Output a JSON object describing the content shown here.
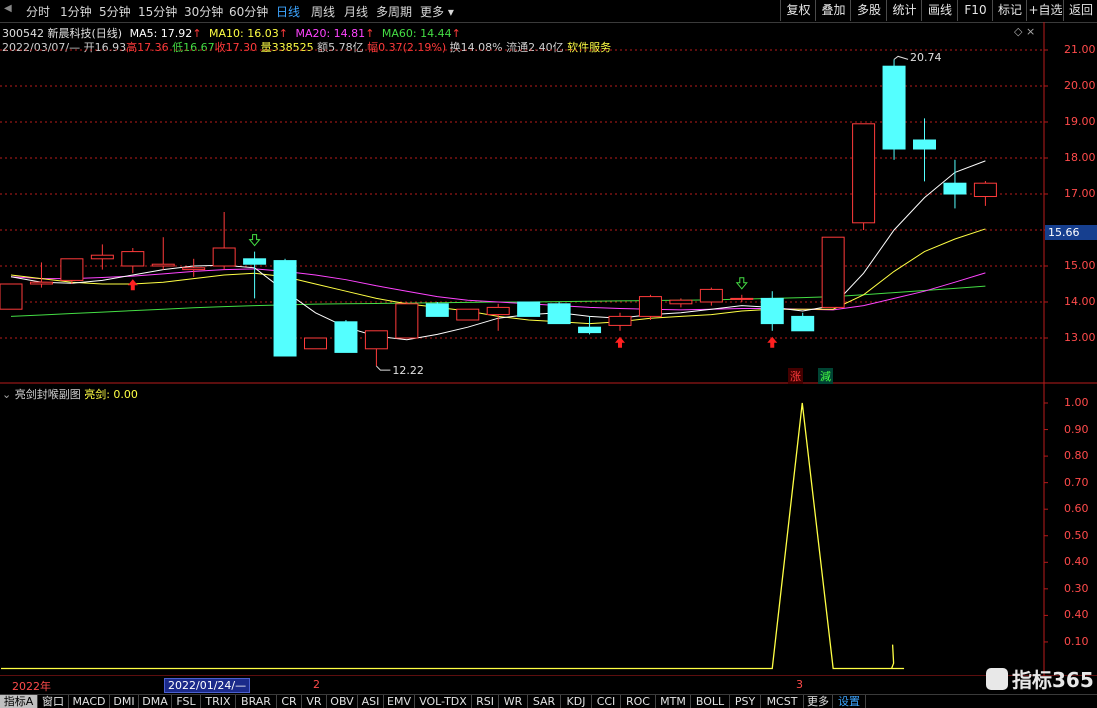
{
  "toolbar": {
    "periods": [
      "分时",
      "1分钟",
      "5分钟",
      "15分钟",
      "30分钟",
      "60分钟",
      "日线",
      "周线",
      "月线",
      "多周期",
      "更多"
    ],
    "active_period": "日线",
    "right_buttons": [
      "复权",
      "叠加",
      "多股",
      "统计",
      "画线",
      "F10",
      "标记",
      "+自选",
      "返回"
    ]
  },
  "stock": {
    "code": "300542",
    "name": "新晨科技(日线)",
    "ma5": "MA5: 17.92",
    "ma10": "MA10: 16.03",
    "ma20": "MA20: 14.81",
    "ma60": "MA60: 14.44"
  },
  "quote": {
    "date": "2022/03/07/—",
    "open": "开16.93",
    "high": "高17.36",
    "low": "低16.67",
    "close": "收17.30",
    "volume": "量338525",
    "amount": "额5.78亿",
    "change": "幅0.37(2.19%)",
    "turnover": "换14.08%",
    "float_cap": "流通2.40亿",
    "industry": "软件服务"
  },
  "main_axis": [
    "21.00",
    "20.00",
    "19.00",
    "18.00",
    "17.00",
    "15.00",
    "14.00",
    "13.00"
  ],
  "price_tag": "15.66",
  "annotations": {
    "high_mark": "20.74",
    "low_mark": "12.22",
    "zhang": "涨",
    "jian": "減"
  },
  "sub_panel": {
    "title": "亮剑封喉副图",
    "indicator": "亮剑: 0.00",
    "axis": [
      "1.00",
      "0.90",
      "0.80",
      "0.70",
      "0.60",
      "0.50",
      "0.40",
      "0.30",
      "0.40",
      "0.10"
    ]
  },
  "time_axis": {
    "year": "2022年",
    "cursor": "2022/01/24/—",
    "feb": "2",
    "mar": "3"
  },
  "bottom_tabs": [
    "指标A",
    "窗口",
    "MACD",
    "DMI",
    "DMA",
    "FSL",
    "TRIX",
    "BRAR",
    "CR",
    "VR",
    "OBV",
    "ASI",
    "EMV",
    "VOL-TDX",
    "RSI",
    "WR",
    "SAR",
    "KDJ",
    "CCI",
    "ROC",
    "MTM",
    "BOLL",
    "PSY",
    "MCST",
    "更多",
    "设置"
  ],
  "watermark": "指标365",
  "colors": {
    "up": "#ff3b3b",
    "down": "#54ffff",
    "ma5": "#ffffff",
    "ma10": "#ffff44",
    "ma20": "#ff44ff",
    "ma60": "#44dd44",
    "axis": "#b81b1b"
  },
  "chart_data": {
    "type": "candlestick",
    "candles": [
      {
        "o": 13.8,
        "h": 14.5,
        "l": 13.8,
        "c": 14.5
      },
      {
        "o": 14.5,
        "h": 15.1,
        "l": 14.4,
        "c": 14.55
      },
      {
        "o": 14.6,
        "h": 15.2,
        "l": 14.5,
        "c": 15.2
      },
      {
        "o": 15.2,
        "h": 15.6,
        "l": 14.9,
        "c": 15.3
      },
      {
        "o": 15.0,
        "h": 15.5,
        "l": 14.8,
        "c": 15.4
      },
      {
        "o": 15.0,
        "h": 15.8,
        "l": 14.9,
        "c": 15.05
      },
      {
        "o": 14.9,
        "h": 15.2,
        "l": 14.7,
        "c": 14.95
      },
      {
        "o": 15.0,
        "h": 16.5,
        "l": 14.9,
        "c": 15.5
      },
      {
        "o": 15.2,
        "h": 15.4,
        "l": 14.1,
        "c": 15.05
      },
      {
        "o": 15.15,
        "h": 15.2,
        "l": 12.5,
        "c": 12.5
      },
      {
        "o": 12.7,
        "h": 13.0,
        "l": 12.7,
        "c": 13.0
      },
      {
        "o": 13.45,
        "h": 13.5,
        "l": 12.6,
        "c": 12.6
      },
      {
        "o": 12.7,
        "h": 13.2,
        "l": 12.22,
        "c": 13.2
      },
      {
        "o": 13.0,
        "h": 14.0,
        "l": 13.0,
        "c": 13.95
      },
      {
        "o": 13.95,
        "h": 14.0,
        "l": 13.6,
        "c": 13.6
      },
      {
        "o": 13.5,
        "h": 13.8,
        "l": 13.5,
        "c": 13.8
      },
      {
        "o": 13.65,
        "h": 13.95,
        "l": 13.2,
        "c": 13.85
      },
      {
        "o": 14.0,
        "h": 14.0,
        "l": 13.6,
        "c": 13.6
      },
      {
        "o": 13.95,
        "h": 14.0,
        "l": 13.4,
        "c": 13.4
      },
      {
        "o": 13.3,
        "h": 13.6,
        "l": 13.1,
        "c": 13.15
      },
      {
        "o": 13.35,
        "h": 13.7,
        "l": 13.2,
        "c": 13.6
      },
      {
        "o": 13.6,
        "h": 14.2,
        "l": 13.5,
        "c": 14.15
      },
      {
        "o": 13.95,
        "h": 14.1,
        "l": 13.85,
        "c": 14.05
      },
      {
        "o": 14.0,
        "h": 14.4,
        "l": 13.9,
        "c": 14.35
      },
      {
        "o": 14.1,
        "h": 14.2,
        "l": 14.0,
        "c": 14.1
      },
      {
        "o": 14.1,
        "h": 14.3,
        "l": 13.2,
        "c": 13.4
      },
      {
        "o": 13.6,
        "h": 13.7,
        "l": 13.2,
        "c": 13.2
      },
      {
        "o": 13.85,
        "h": 15.8,
        "l": 13.85,
        "c": 15.8
      },
      {
        "o": 16.2,
        "h": 18.95,
        "l": 16.0,
        "c": 18.95
      },
      {
        "o": 20.55,
        "h": 20.74,
        "l": 17.95,
        "c": 18.25
      },
      {
        "o": 18.5,
        "h": 19.1,
        "l": 17.35,
        "c": 18.25
      },
      {
        "o": 17.3,
        "h": 17.95,
        "l": 16.6,
        "c": 17.0
      },
      {
        "o": 16.93,
        "h": 17.36,
        "l": 16.67,
        "c": 17.3
      }
    ],
    "ma5": [
      14.7,
      14.55,
      14.52,
      14.6,
      14.75,
      14.9,
      15.0,
      15.02,
      14.95,
      14.3,
      13.7,
      13.3,
      13.05,
      12.95,
      13.1,
      13.3,
      13.55,
      13.65,
      13.7,
      13.6,
      13.55,
      13.65,
      13.7,
      13.8,
      13.9,
      13.85,
      13.75,
      13.9,
      14.8,
      16.0,
      16.9,
      17.6,
      17.92
    ],
    "ma10": [
      14.75,
      14.65,
      14.55,
      14.5,
      14.5,
      14.55,
      14.65,
      14.75,
      14.8,
      14.7,
      14.5,
      14.3,
      14.1,
      13.95,
      13.85,
      13.75,
      13.6,
      13.5,
      13.45,
      13.4,
      13.45,
      13.55,
      13.6,
      13.65,
      13.75,
      13.8,
      13.8,
      13.8,
      14.2,
      14.85,
      15.4,
      15.75,
      16.03
    ],
    "ma20": [
      14.7,
      14.65,
      14.65,
      14.68,
      14.72,
      14.78,
      14.85,
      14.9,
      14.92,
      14.85,
      14.75,
      14.62,
      14.45,
      14.3,
      14.15,
      14.05,
      14.0,
      13.95,
      13.9,
      13.85,
      13.82,
      13.8,
      13.78,
      13.8,
      13.82,
      13.82,
      13.8,
      13.78,
      13.9,
      14.1,
      14.3,
      14.55,
      14.81
    ],
    "ma60": [
      13.6,
      13.64,
      13.68,
      13.72,
      13.76,
      13.8,
      13.84,
      13.87,
      13.9,
      13.92,
      13.94,
      13.95,
      13.96,
      13.97,
      13.98,
      13.99,
      14.0,
      14.0,
      14.01,
      14.02,
      14.03,
      14.04,
      14.05,
      14.06,
      14.08,
      14.1,
      14.12,
      14.15,
      14.2,
      14.26,
      14.32,
      14.38,
      14.44
    ],
    "signals": {
      "up_arrows": [
        4,
        20,
        25
      ],
      "down_arrows": [
        8,
        24
      ]
    },
    "ylim": [
      12.0,
      21.6
    ],
    "sub_chart": {
      "type": "line",
      "name": "亮剑",
      "values": [
        0,
        0,
        0,
        0,
        0,
        0,
        0,
        0,
        0,
        0,
        0,
        0,
        0,
        0,
        0,
        0,
        0,
        0,
        0,
        0,
        0,
        0,
        0,
        0,
        0,
        0,
        0,
        1.0,
        0,
        0,
        0,
        0.1
      ],
      "ylim": [
        0.0,
        1.03
      ]
    }
  }
}
